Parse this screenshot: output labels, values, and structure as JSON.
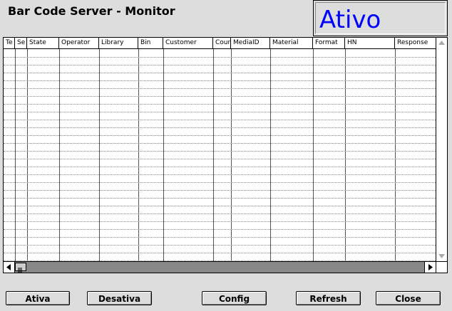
{
  "window": {
    "title": "Bar Code Server - Monitor"
  },
  "status": {
    "text": "Ativo",
    "color": "#0000ff"
  },
  "table": {
    "columns": [
      "Te",
      "Se",
      "State",
      "Operator",
      "Library",
      "Bin",
      "Customer",
      "Coun",
      "MediaID",
      "Material",
      "Format",
      "HN",
      "Response"
    ],
    "rows": []
  },
  "buttons": {
    "ativa": "Ativa",
    "desativa": "Desativa",
    "config": "Config",
    "refresh": "Refresh",
    "close": "Close"
  },
  "icons": {
    "scroll_left": "arrow-left-icon",
    "scroll_right": "arrow-right-icon",
    "scroll_up": "arrow-up-icon",
    "scroll_down": "arrow-down-icon"
  }
}
